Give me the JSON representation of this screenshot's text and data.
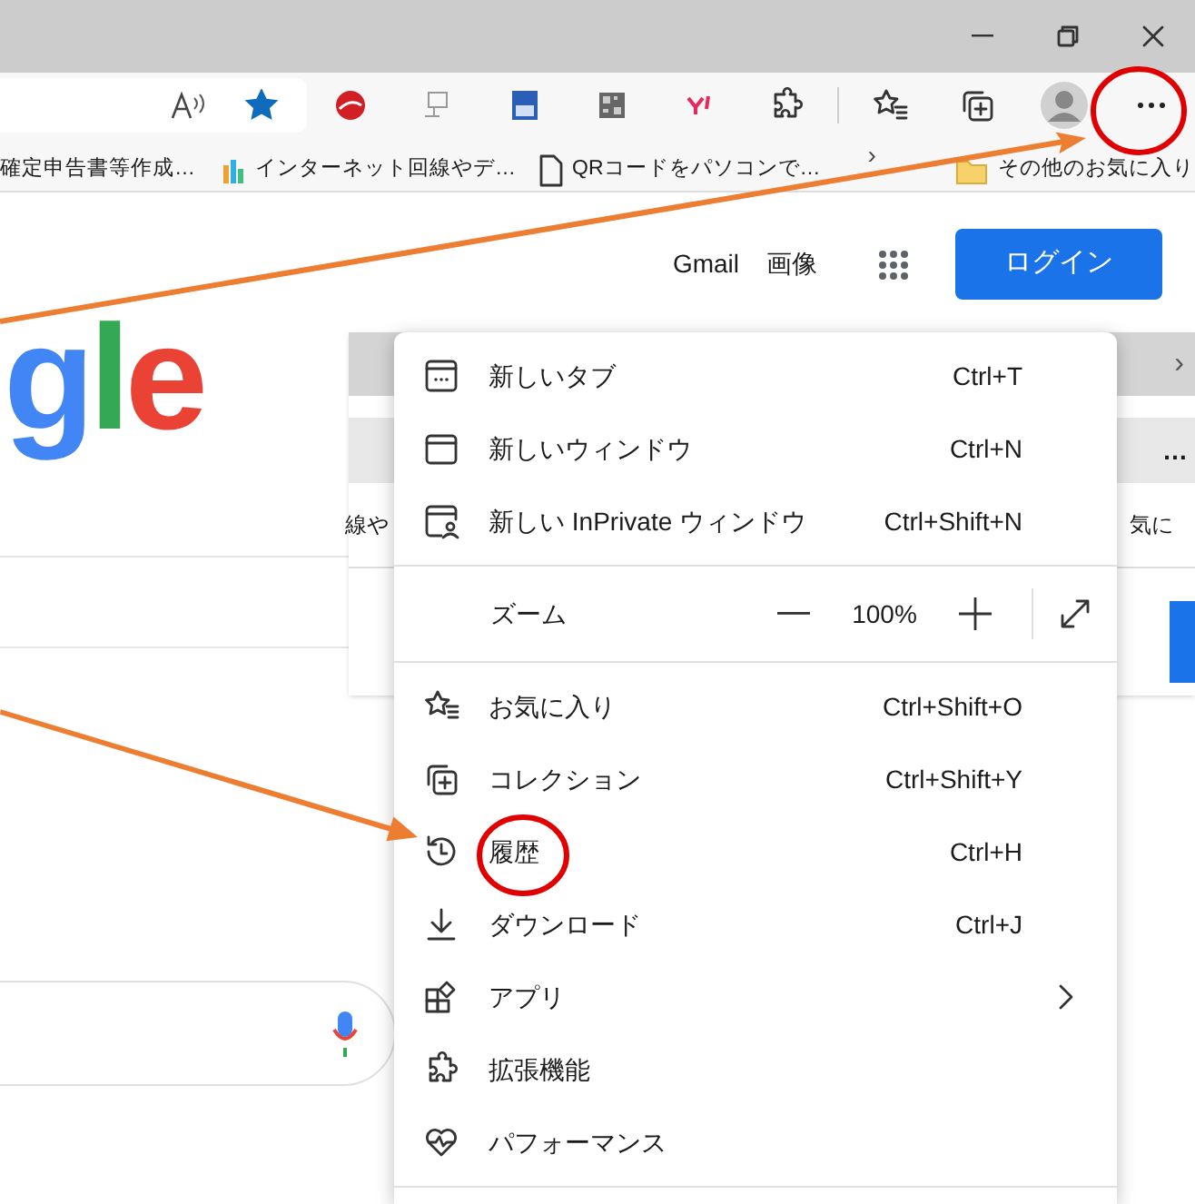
{
  "address_bar": {
    "favorite": true
  },
  "bookmarks": [
    {
      "kind": "plain",
      "label": "確定申告書等作成…"
    },
    {
      "kind": "colorful",
      "label": "インターネット回線やデ…"
    },
    {
      "kind": "document",
      "label": "QRコードをパソコンで…"
    },
    {
      "kind": "overflow",
      "label": "›"
    },
    {
      "kind": "folder",
      "label": "その他のお気に入り"
    }
  ],
  "page": {
    "header_links": [
      "Gmail",
      "画像"
    ],
    "login_button": "ログイン",
    "logo": [
      {
        "text": "g",
        "color": "#4285f4"
      },
      {
        "text": "l",
        "color": "#34a853"
      },
      {
        "text": "e",
        "color": "#ea4335"
      }
    ]
  },
  "background_window": {
    "overflow_arrow": "›",
    "more": "…",
    "left_text": "線や",
    "right_text": "気に"
  },
  "menu": {
    "items": [
      {
        "kind": "item",
        "label": "新しいタブ",
        "shortcut": "Ctrl+T"
      },
      {
        "kind": "item",
        "label": "新しいウィンドウ",
        "shortcut": "Ctrl+N"
      },
      {
        "kind": "item",
        "label": "新しい InPrivate ウィンドウ",
        "shortcut": "Ctrl+Shift+N"
      },
      {
        "kind": "divider"
      },
      {
        "kind": "zoom",
        "label": "ズーム",
        "value": "100%"
      },
      {
        "kind": "divider"
      },
      {
        "kind": "item",
        "label": "お気に入り",
        "shortcut": "Ctrl+Shift+O"
      },
      {
        "kind": "item",
        "label": "コレクション",
        "shortcut": "Ctrl+Shift+Y"
      },
      {
        "kind": "item",
        "label": "履歴",
        "shortcut": "Ctrl+H"
      },
      {
        "kind": "item",
        "label": "ダウンロード",
        "shortcut": "Ctrl+J"
      },
      {
        "kind": "item",
        "label": "アプリ",
        "submenu": true
      },
      {
        "kind": "item",
        "label": "拡張機能"
      },
      {
        "kind": "item",
        "label": "パフォーマンス"
      },
      {
        "kind": "divider"
      }
    ]
  },
  "annotations": [
    {
      "kind": "arrow"
    },
    {
      "kind": "arrow"
    },
    {
      "kind": "circle"
    },
    {
      "kind": "circle"
    }
  ]
}
